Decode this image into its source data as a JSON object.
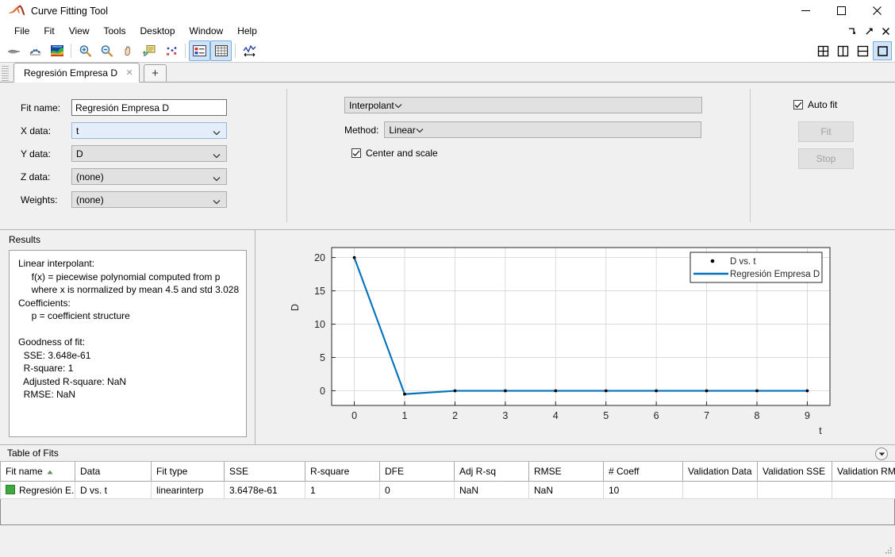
{
  "window": {
    "title": "Curve Fitting Tool",
    "controls": {
      "minimize": "─",
      "maximize": "□",
      "close": "✕"
    }
  },
  "menubar": {
    "items": [
      "File",
      "Fit",
      "View",
      "Tools",
      "Desktop",
      "Window",
      "Help"
    ],
    "right_icons": [
      "dock-arrow-icon",
      "undock-arrow-icon",
      "close-icon"
    ]
  },
  "toolbar": {
    "left_tools": [
      "fit-curve-icon",
      "fit-surface-icon",
      "surface-plot-icon",
      "zoom-in-icon",
      "zoom-out-icon",
      "pan-icon",
      "data-cursor-icon",
      "exclude-outliers-icon",
      "legend-icon",
      "grid-icon",
      "axes-limits-icon"
    ],
    "layout_buttons": [
      "layout-grid-icon",
      "layout-columns-icon",
      "layout-rows-icon",
      "layout-single-icon"
    ],
    "active_layout": 3
  },
  "tabs": {
    "items": [
      {
        "label": "Regresión Empresa D",
        "close": "✕",
        "active": true
      }
    ],
    "add_label": "+"
  },
  "settings": {
    "fit_name_label": "Fit name:",
    "fit_name_value": "Regresión Empresa D",
    "x_data_label": "X data:",
    "x_data_value": "t",
    "y_data_label": "Y data:",
    "y_data_value": "D",
    "z_data_label": "Z data:",
    "z_data_value": "(none)",
    "weights_label": "Weights:",
    "weights_value": "(none)",
    "fit_type_value": "Interpolant",
    "method_label": "Method:",
    "method_value": "Linear",
    "center_scale_label": "Center and scale",
    "center_scale_checked": true,
    "auto_fit_label": "Auto fit",
    "auto_fit_checked": true,
    "fit_button": "Fit",
    "stop_button": "Stop"
  },
  "results": {
    "title": "Results",
    "lines": [
      "Linear interpolant:",
      "     f(x) = piecewise polynomial computed from p",
      "     where x is normalized by mean 4.5 and std 3.028",
      "Coefficients:",
      "     p = coefficient structure",
      "",
      "Goodness of fit:",
      "  SSE: 3.648e-61",
      "  R-square: 1",
      "  Adjusted R-square: NaN",
      "  RMSE: NaN"
    ]
  },
  "chart_data": {
    "type": "line",
    "title": "",
    "xlabel": "t",
    "ylabel": "D",
    "xlim": [
      -0.45,
      9.45
    ],
    "ylim": [
      -2.2,
      21.5
    ],
    "xticks": [
      0,
      1,
      2,
      3,
      4,
      5,
      6,
      7,
      8,
      9
    ],
    "yticks": [
      0,
      5,
      10,
      15,
      20
    ],
    "grid": true,
    "legend_position": "top-right",
    "series": [
      {
        "name": "D vs. t",
        "kind": "scatter",
        "marker": "dot",
        "color": "#000000",
        "x": [
          0,
          1,
          2,
          3,
          4,
          5,
          6,
          7,
          8,
          9
        ],
        "values": [
          20,
          -0.5,
          0,
          0,
          0,
          0,
          0,
          0,
          0,
          0
        ]
      },
      {
        "name": "Regresión Empresa D",
        "kind": "line",
        "color": "#0072bd",
        "x": [
          0,
          1,
          2,
          3,
          4,
          5,
          6,
          7,
          8,
          9
        ],
        "values": [
          20,
          -0.5,
          0,
          0,
          0,
          0,
          0,
          0,
          0,
          0
        ]
      }
    ]
  },
  "table_of_fits": {
    "title": "Table of Fits",
    "columns": [
      "Fit name",
      "Data",
      "Fit type",
      "SSE",
      "R-square",
      "DFE",
      "Adj R-sq",
      "RMSE",
      "# Coeff",
      "Validation Data",
      "Validation SSE",
      "Validation RM..."
    ],
    "sort_column": 0,
    "sort_direction": "asc",
    "rows": [
      {
        "swatch_color": "#3ea93e",
        "cells": [
          "Regresión E...",
          "D vs. t",
          "linearinterp",
          "3.6478e-61",
          "1",
          "0",
          "NaN",
          "NaN",
          "10",
          "",
          "",
          ""
        ]
      }
    ]
  }
}
